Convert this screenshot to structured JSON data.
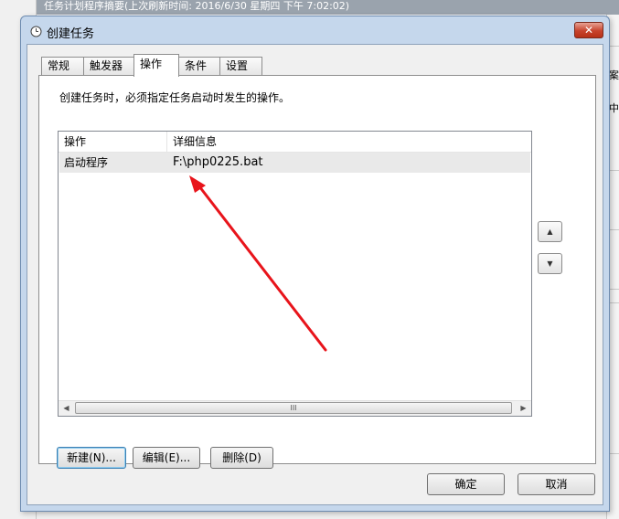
{
  "background": {
    "title": "任务计划程序摘要(上次刷新时间: 2016/6/30 星期四 下午 7:02:02)",
    "right_text_1": "案",
    "right_text_2": "中"
  },
  "dialog": {
    "title": "创建任务",
    "icon": "clock-icon",
    "close_label": "✕"
  },
  "tabs": [
    {
      "label": "常规",
      "active": false
    },
    {
      "label": "触发器",
      "active": false
    },
    {
      "label": "操作",
      "active": true
    },
    {
      "label": "条件",
      "active": false
    },
    {
      "label": "设置",
      "active": false
    }
  ],
  "actions": {
    "description": "创建任务时，必须指定任务启动时发生的操作。",
    "columns": [
      "操作",
      "详细信息"
    ],
    "rows": [
      {
        "action": "启动程序",
        "details": "F:\\php0225.bat"
      }
    ],
    "scroll_grip": "III",
    "buttons": {
      "new": "新建(N)...",
      "edit": "编辑(E)...",
      "delete": "删除(D)"
    },
    "move_up": "▲",
    "move_down": "▼"
  },
  "footer": {
    "ok": "确定",
    "cancel": "取消"
  },
  "colors": {
    "annotation_arrow": "#e8141b",
    "dialog_frame": "#c5d7ec",
    "close_button": "#c7432c"
  }
}
